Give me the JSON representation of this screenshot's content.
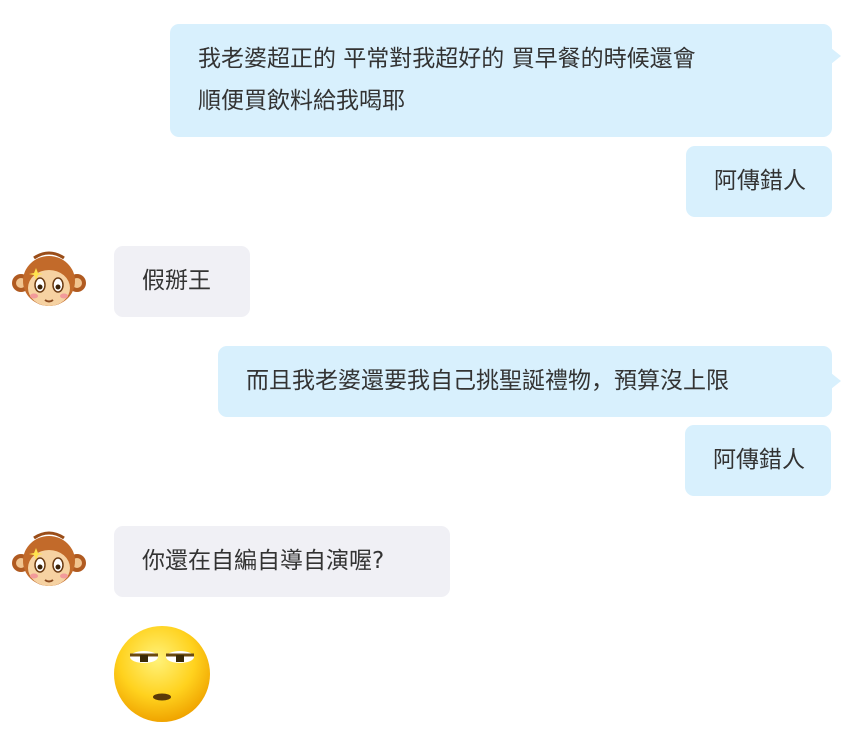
{
  "messages": [
    {
      "side": "out",
      "lines": [
        "我老婆超正的  平常對我超好的    買早餐的時候還會",
        "順便買飲料給我喝耶"
      ]
    },
    {
      "side": "out",
      "text": "阿傳錯人"
    },
    {
      "side": "in",
      "text": "假掰王",
      "avatar": "monkey-avatar"
    },
    {
      "side": "out",
      "text": "而且我老婆還要我自己挑聖誕禮物，預算沒上限"
    },
    {
      "side": "out",
      "text": "阿傳錯人"
    },
    {
      "side": "in",
      "text": "你還在自編自導自演喔?",
      "avatar": "monkey-avatar"
    },
    {
      "side": "in",
      "sticker": "eye-roll-emoji"
    }
  ],
  "colors": {
    "outgoing_bubble": "#d8f0fd",
    "incoming_bubble": "#f0f0f5",
    "text": "#333333"
  }
}
